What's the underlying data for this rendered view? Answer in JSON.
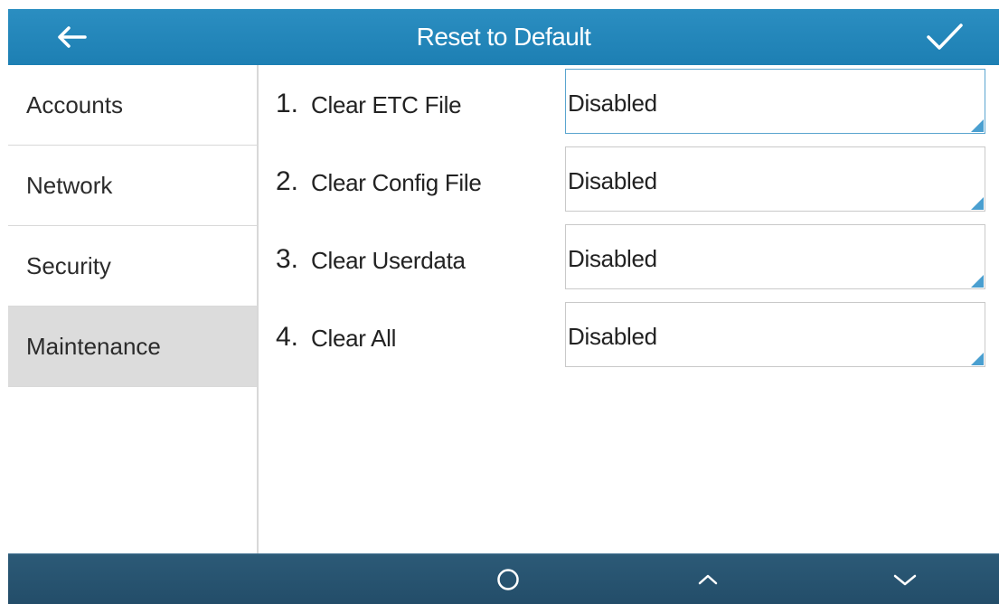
{
  "header": {
    "title": "Reset to Default",
    "back_icon": "arrow-left-icon",
    "confirm_icon": "checkmark-icon"
  },
  "sidebar": {
    "items": [
      {
        "label": "Accounts",
        "active": false
      },
      {
        "label": "Network",
        "active": false
      },
      {
        "label": "Security",
        "active": false
      },
      {
        "label": "Maintenance",
        "active": true
      }
    ]
  },
  "main": {
    "rows": [
      {
        "number": "1.",
        "label": "Clear ETC File",
        "value": "Disabled",
        "focused": true
      },
      {
        "number": "2.",
        "label": "Clear Config File",
        "value": "Disabled",
        "focused": false
      },
      {
        "number": "3.",
        "label": "Clear Userdata",
        "value": "Disabled",
        "focused": false
      },
      {
        "number": "4.",
        "label": "Clear All",
        "value": "Disabled",
        "focused": false
      }
    ]
  },
  "bottombar": {
    "keys": [
      "circle-icon",
      "chevron-up-icon",
      "chevron-down-icon"
    ]
  },
  "colors": {
    "header": "#2387bb",
    "bottombar": "#275370",
    "accent": "#4a9fd0",
    "sidebar_active": "#dcdcdc"
  }
}
